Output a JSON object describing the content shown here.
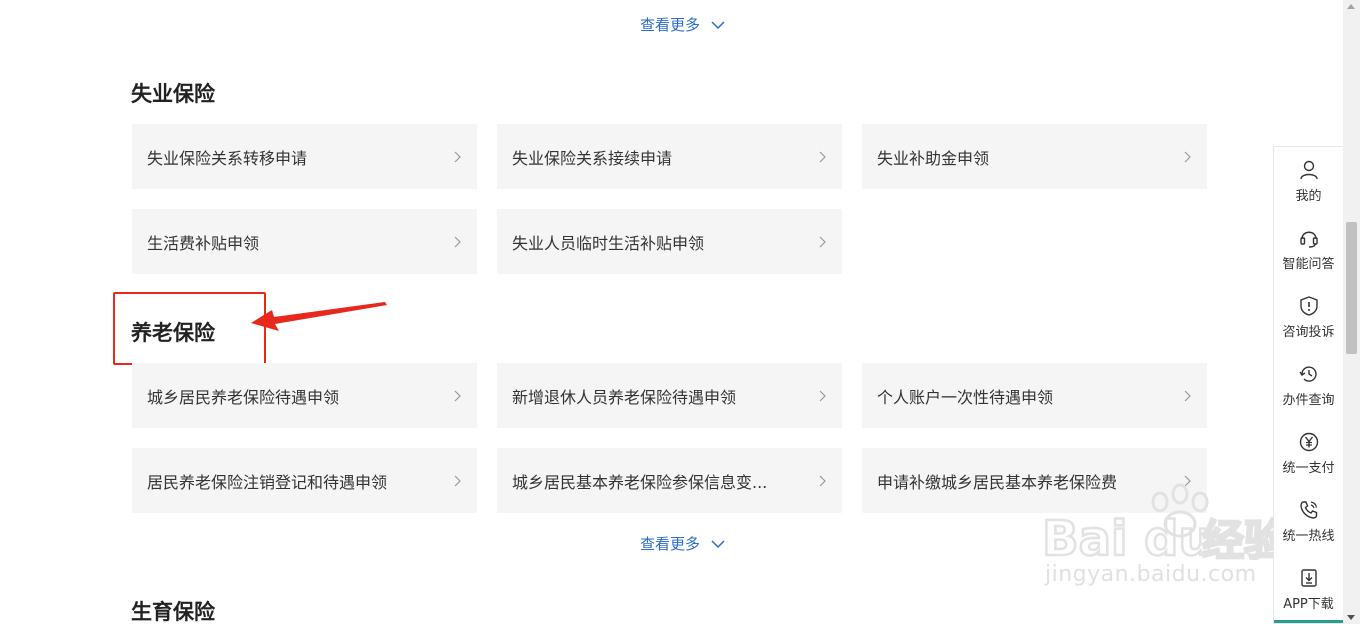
{
  "show_more_label": "查看更多",
  "sections": [
    {
      "title": "失业保险",
      "items": [
        "失业保险关系转移申请",
        "失业保险关系接续申请",
        "失业补助金申领",
        "生活费补贴申领",
        "失业人员临时生活补贴申领"
      ]
    },
    {
      "title": "养老保险",
      "items": [
        "城乡居民养老保险待遇申领",
        "新增退休人员养老保险待遇申领",
        "个人账户一次性待遇申领",
        "居民养老保险注销登记和待遇申领",
        "城乡居民基本养老保险参保信息变...",
        "申请补缴城乡居民基本养老保险费"
      ]
    },
    {
      "title": "生育保险"
    }
  ],
  "sidebar": {
    "items": [
      {
        "label": "我的",
        "icon": "user-icon"
      },
      {
        "label": "智能问答",
        "icon": "headset-icon"
      },
      {
        "label": "咨询投诉",
        "icon": "shield-alert-icon"
      },
      {
        "label": "办件查询",
        "icon": "history-icon"
      },
      {
        "label": "统一支付",
        "icon": "yen-icon"
      },
      {
        "label": "统一热线",
        "icon": "phone-icon"
      },
      {
        "label": "APP下载",
        "icon": "download-icon"
      }
    ]
  },
  "watermark": {
    "text": "jingyan.baidu.com",
    "brand": "Baidu经验"
  },
  "colors": {
    "accent": "#2a6cc8",
    "highlight": "#e8281c",
    "card_bg": "#f5f5f5"
  }
}
